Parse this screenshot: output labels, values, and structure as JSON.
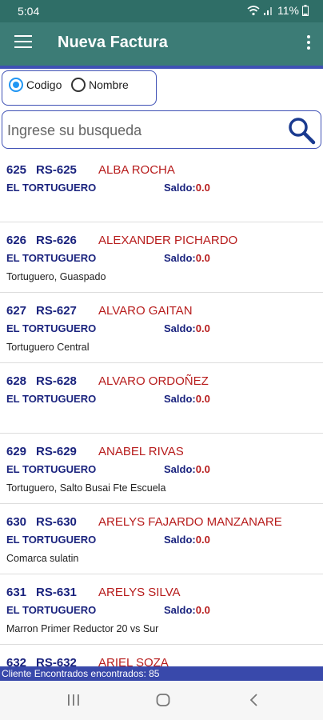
{
  "status": {
    "time": "5:04",
    "battery": "11%"
  },
  "appbar": {
    "title": "Nueva Factura"
  },
  "filter": {
    "option_code": "Codigo",
    "option_name": "Nombre",
    "selected": "Codigo"
  },
  "search": {
    "placeholder": "Ingrese su busqueda"
  },
  "clients": [
    {
      "code": "625",
      "ref": "RS-625",
      "name": "ALBA ROCHA",
      "zone": "EL TORTUGUERO",
      "saldo_label": "Saldo:",
      "saldo": "0.0",
      "address": ""
    },
    {
      "code": "626",
      "ref": "RS-626",
      "name": "ALEXANDER PICHARDO",
      "zone": "EL TORTUGUERO",
      "saldo_label": "Saldo:",
      "saldo": "0.0",
      "address": "Tortuguero, Guaspado"
    },
    {
      "code": "627",
      "ref": "RS-627",
      "name": "ALVARO GAITAN",
      "zone": "EL TORTUGUERO",
      "saldo_label": "Saldo:",
      "saldo": "0.0",
      "address": "Tortuguero Central"
    },
    {
      "code": "628",
      "ref": "RS-628",
      "name": "ALVARO ORDOÑEZ",
      "zone": "EL TORTUGUERO",
      "saldo_label": "Saldo:",
      "saldo": "0.0",
      "address": ""
    },
    {
      "code": "629",
      "ref": "RS-629",
      "name": "ANABEL RIVAS",
      "zone": "EL TORTUGUERO",
      "saldo_label": "Saldo:",
      "saldo": "0.0",
      "address": "Tortuguero, Salto Busai Fte Escuela"
    },
    {
      "code": "630",
      "ref": "RS-630",
      "name": "ARELYS FAJARDO MANZANARE",
      "zone": "EL TORTUGUERO",
      "saldo_label": "Saldo:",
      "saldo": "0.0",
      "address": "Comarca sulatin"
    },
    {
      "code": "631",
      "ref": "RS-631",
      "name": "ARELYS SILVA",
      "zone": "EL TORTUGUERO",
      "saldo_label": "Saldo:",
      "saldo": "0.0",
      "address": "Marron Primer Reductor 20 vs Sur"
    },
    {
      "code": "632",
      "ref": "RS-632",
      "name": "ARIEL SOZA",
      "zone": "",
      "saldo_label": "",
      "saldo": "",
      "address": ""
    }
  ],
  "footer": {
    "text": "Cliente Encontrados encontrados: 85"
  },
  "icons": {
    "menu": "hamburger-menu-icon",
    "more": "more-vert-icon",
    "search": "search-icon",
    "wifi": "wifi-icon",
    "signal": "signal-icon",
    "battery": "battery-icon",
    "recents": "recents-icon",
    "home": "home-icon",
    "back": "back-icon"
  },
  "colors": {
    "appbar": "#3c7c76",
    "statusbar": "#2f6e67",
    "accent": "#3f51b5",
    "code": "#1a237e",
    "name": "#b71c1c",
    "radio": "#2196f3"
  }
}
